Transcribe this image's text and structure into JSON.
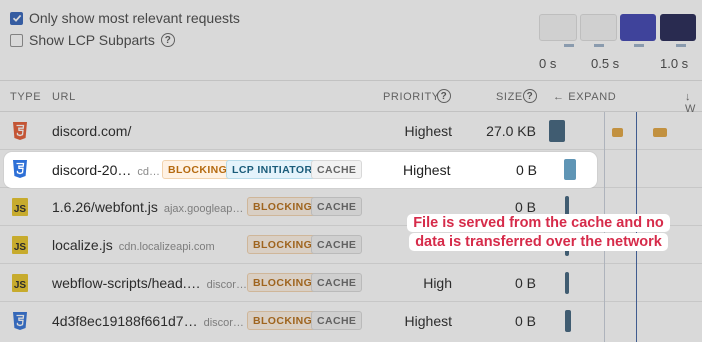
{
  "options": {
    "relevant_label": "Only show most relevant requests",
    "relevant_checked": true,
    "lcp_label": "Show LCP Subparts",
    "lcp_checked": false
  },
  "filmstrip": {
    "ticks": [
      "0 s",
      "0.5 s",
      "1.0 s"
    ]
  },
  "table": {
    "headers": {
      "type": "TYPE",
      "url": "URL",
      "priority": "PRIORITY",
      "size": "SIZE",
      "expand": "EXPAND",
      "w": "W"
    },
    "rows": [
      {
        "type": "html-icon",
        "name": "discord.com/",
        "domain": "",
        "badges": [],
        "priority": "Highest",
        "size": "27.0 KB",
        "bar_color": "#3b5f7a"
      },
      {
        "type": "css-icon",
        "name": "discord-20…",
        "domain": "cd…",
        "badges": [
          "BLOCKING",
          "LCP INITIATOR",
          "CACHE"
        ],
        "priority": "Highest",
        "size": "0 B",
        "bar_color": "#5f95b5"
      },
      {
        "type": "js-icon",
        "name": "1.6.26/webfont.js",
        "domain": "ajax.googleap…",
        "badges": [
          "BLOCKING",
          "CACHE"
        ],
        "priority": "",
        "size": "0 B",
        "bar_color": "#3b5f7a"
      },
      {
        "type": "js-icon",
        "name": "localize.js",
        "domain": "cdn.localizeapi.com",
        "badges": [
          "BLOCKING",
          "CACHE"
        ],
        "priority": "",
        "size": "0 B",
        "bar_color": "#3b5f7a"
      },
      {
        "type": "js-icon",
        "name": "webflow-scripts/head.…",
        "domain": "discor…",
        "badges": [
          "BLOCKING",
          "CACHE"
        ],
        "priority": "High",
        "size": "0 B",
        "bar_color": "#3b5f7a"
      },
      {
        "type": "css-icon",
        "name": "4d3f8ec19188f661d7…",
        "domain": "discor…",
        "badges": [
          "BLOCKING",
          "CACHE"
        ],
        "priority": "Highest",
        "size": "0 B",
        "bar_color": "#3b5f7a"
      }
    ]
  },
  "callout": {
    "text": "File is served from the cache and no data is transferred over the network"
  }
}
